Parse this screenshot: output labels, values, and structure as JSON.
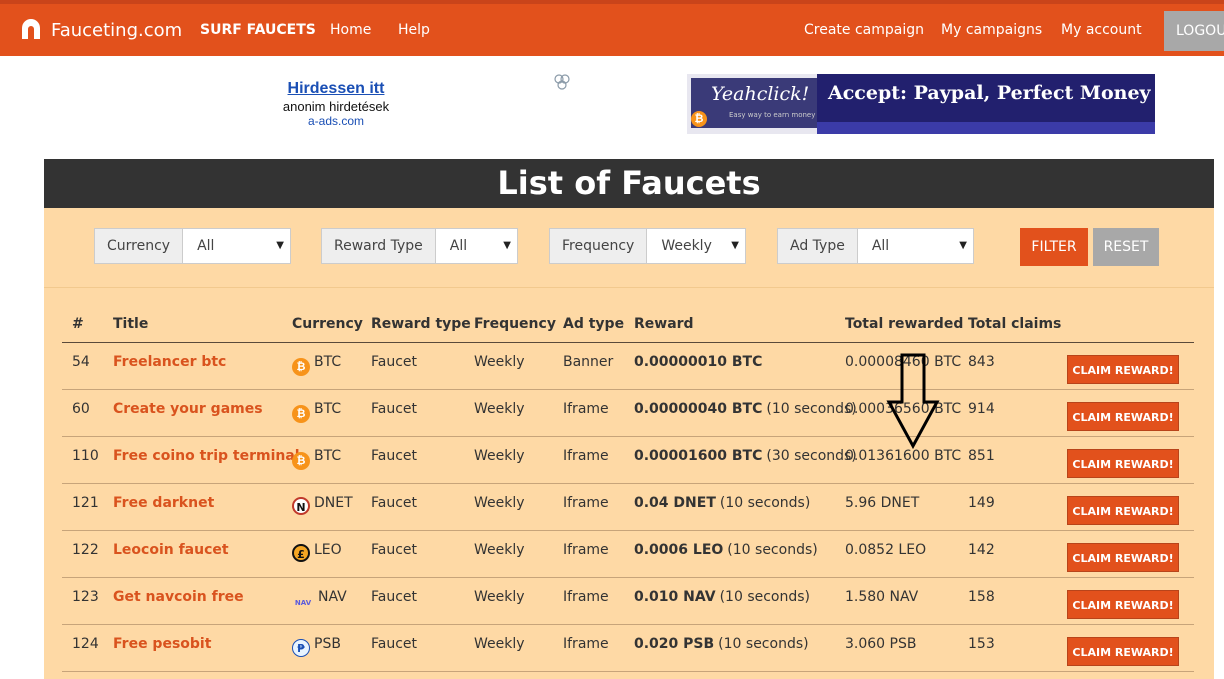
{
  "header": {
    "brand": "Fauceting.com",
    "nav_left": [
      "SURF FAUCETS",
      "Home",
      "Help"
    ],
    "nav_right": [
      "Create campaign",
      "My campaigns",
      "My account"
    ],
    "logout": "LOGOUT"
  },
  "ads": {
    "text_ad": {
      "headline": "Hirdessen itt",
      "subline": "anonim hirdetések",
      "domain": "a-ads.com"
    },
    "banner": {
      "brand": "Yeahclick!",
      "tagline": "Easy way to earn money",
      "message": "Accept: Paypal, Perfect Money"
    }
  },
  "page": {
    "title": "List of Faucets"
  },
  "filters": [
    {
      "label": "Currency",
      "value": "All"
    },
    {
      "label": "Reward Type",
      "value": "All"
    },
    {
      "label": "Frequency",
      "value": "Weekly"
    },
    {
      "label": "Ad Type",
      "value": "All"
    }
  ],
  "buttons": {
    "filter": "FILTER",
    "reset": "RESET"
  },
  "table": {
    "headers": [
      "#",
      "Title",
      "Currency",
      "Reward type",
      "Frequency",
      "Ad type",
      "Reward",
      "Total rewarded",
      "Total claims"
    ],
    "claim_label": "CLAIM REWARD!",
    "rows": [
      {
        "id": "54",
        "title": "Freelancer btc",
        "icon": "bitcoin-icon",
        "currency": "BTC",
        "reward_type": "Faucet",
        "frequency": "Weekly",
        "ad_type": "Banner",
        "reward_amount": "0.00000010 BTC",
        "reward_extra": "",
        "total_rewarded": "0.00008460 BTC",
        "total_claims": "843"
      },
      {
        "id": "60",
        "title": "Create your games",
        "icon": "bitcoin-icon",
        "currency": "BTC",
        "reward_type": "Faucet",
        "frequency": "Weekly",
        "ad_type": "Iframe",
        "reward_amount": "0.00000040 BTC",
        "reward_extra": "(10 seconds)",
        "total_rewarded": "0.00036560 BTC",
        "total_claims": "914"
      },
      {
        "id": "110",
        "title": "Free coino trip terminal",
        "icon": "bitcoin-icon",
        "currency": "BTC",
        "reward_type": "Faucet",
        "frequency": "Weekly",
        "ad_type": "Iframe",
        "reward_amount": "0.00001600 BTC",
        "reward_extra": "(30 seconds)",
        "total_rewarded": "0.01361600 BTC",
        "total_claims": "851"
      },
      {
        "id": "121",
        "title": "Free darknet",
        "icon": "darknet-icon",
        "currency": "DNET",
        "reward_type": "Faucet",
        "frequency": "Weekly",
        "ad_type": "Iframe",
        "reward_amount": "0.04 DNET",
        "reward_extra": "(10 seconds)",
        "total_rewarded": "5.96 DNET",
        "total_claims": "149"
      },
      {
        "id": "122",
        "title": "Leocoin faucet",
        "icon": "leocoin-icon",
        "currency": "LEO",
        "reward_type": "Faucet",
        "frequency": "Weekly",
        "ad_type": "Iframe",
        "reward_amount": "0.0006 LEO",
        "reward_extra": "(10 seconds)",
        "total_rewarded": "0.0852 LEO",
        "total_claims": "142"
      },
      {
        "id": "123",
        "title": "Get navcoin free",
        "icon": "navcoin-icon",
        "currency": "NAV",
        "reward_type": "Faucet",
        "frequency": "Weekly",
        "ad_type": "Iframe",
        "reward_amount": "0.010 NAV",
        "reward_extra": "(10 seconds)",
        "total_rewarded": "1.580 NAV",
        "total_claims": "158"
      },
      {
        "id": "124",
        "title": "Free pesobit",
        "icon": "pesobit-icon",
        "currency": "PSB",
        "reward_type": "Faucet",
        "frequency": "Weekly",
        "ad_type": "Iframe",
        "reward_amount": "0.020 PSB",
        "reward_extra": "(10 seconds)",
        "total_rewarded": "3.060 PSB",
        "total_claims": "153"
      }
    ]
  },
  "colors": {
    "accent": "#e2511c",
    "panel_bg": "#fed9a5",
    "title_bar": "#333333",
    "link": "#d9531e",
    "reset": "#a8a8a8"
  }
}
